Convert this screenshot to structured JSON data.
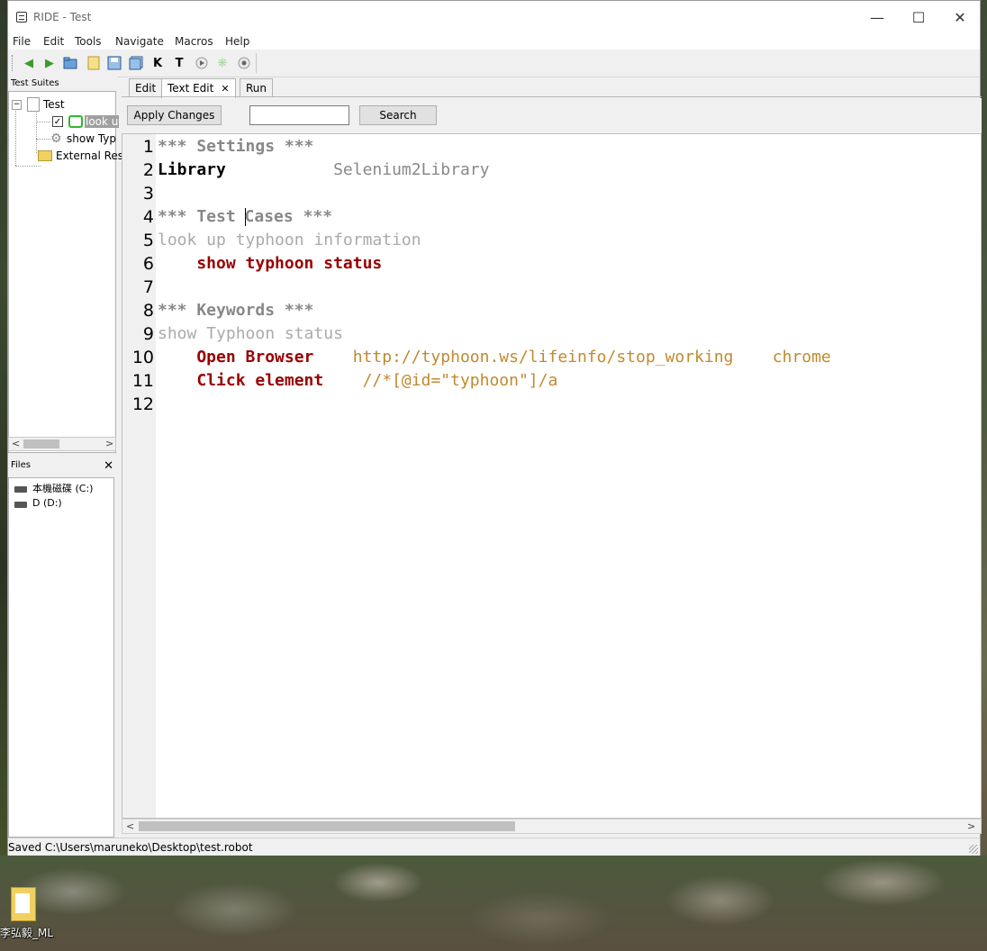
{
  "window": {
    "title": "RIDE - Test"
  },
  "menu": [
    "File",
    "Edit",
    "Tools",
    "Navigate",
    "Macros",
    "Help"
  ],
  "toolbar_icons": [
    "back-arrow-icon",
    "forward-arrow-icon",
    "open-folder-icon",
    "new-file-icon",
    "save-icon",
    "save-all-icon",
    "keyword-search-icon",
    "test-search-icon",
    "run-icon",
    "settings-icon",
    "stop-icon"
  ],
  "toolbar_glyphs": {
    "keyword_search": "K",
    "test_search": "T"
  },
  "test_suites": {
    "header": "Test Suites",
    "items": [
      {
        "label": "Test"
      },
      {
        "label": "look u",
        "selected": true,
        "checked": true
      },
      {
        "label": "show Typ"
      },
      {
        "label": "External Res"
      }
    ]
  },
  "files": {
    "header": "Files",
    "drives": [
      "本機磁碟 (C:)",
      "D (D:)"
    ]
  },
  "tabs": [
    {
      "label": "Edit"
    },
    {
      "label": "Text Edit",
      "active": true
    },
    {
      "label": "Run"
    }
  ],
  "editor_controls": {
    "apply_label": "Apply Changes",
    "search_label": "Search",
    "search_value": ""
  },
  "editor": {
    "lines": [
      {
        "n": "1",
        "parts": [
          {
            "t": "*** Settings ***",
            "c": "c-head"
          }
        ]
      },
      {
        "n": "2",
        "parts": [
          {
            "t": "Library",
            "c": "c-lib"
          },
          {
            "t": "           Selenium2Library",
            "c": "c-libname"
          }
        ]
      },
      {
        "n": "3",
        "parts": []
      },
      {
        "n": "4",
        "parts": [
          {
            "t": "*** Test ",
            "c": "c-head"
          },
          {
            "t": "Cases ***",
            "c": "c-head"
          }
        ]
      },
      {
        "n": "5",
        "parts": [
          {
            "t": "look up typhoon information",
            "c": "c-tc"
          }
        ]
      },
      {
        "n": "6",
        "parts": [
          {
            "t": "    show typhoon status",
            "c": "c-kw"
          }
        ]
      },
      {
        "n": "7",
        "parts": []
      },
      {
        "n": "8",
        "parts": [
          {
            "t": "*** Keywords ***",
            "c": "c-head"
          }
        ]
      },
      {
        "n": "9",
        "parts": [
          {
            "t": "show Typhoon status",
            "c": "c-tc"
          }
        ]
      },
      {
        "n": "10",
        "parts": [
          {
            "t": "    Open Browser",
            "c": "c-kw"
          },
          {
            "t": "    http://typhoon.ws/lifeinfo/stop_working    chrome",
            "c": "c-arg"
          }
        ]
      },
      {
        "n": "11",
        "parts": [
          {
            "t": "    Click element",
            "c": "c-kw"
          },
          {
            "t": "    //*[@id=\"typhoon\"]/a",
            "c": "c-arg"
          }
        ]
      },
      {
        "n": "12",
        "parts": []
      }
    ]
  },
  "status_bar": "Saved C:\\Users\\maruneko\\Desktop\\test.robot",
  "desktop": {
    "icon_label": "李弘毅_ML"
  },
  "colors": {
    "section_header": "#888888",
    "keyword": "#990000",
    "argument": "#c08a30",
    "test_case_name": "#aaaaaa"
  }
}
